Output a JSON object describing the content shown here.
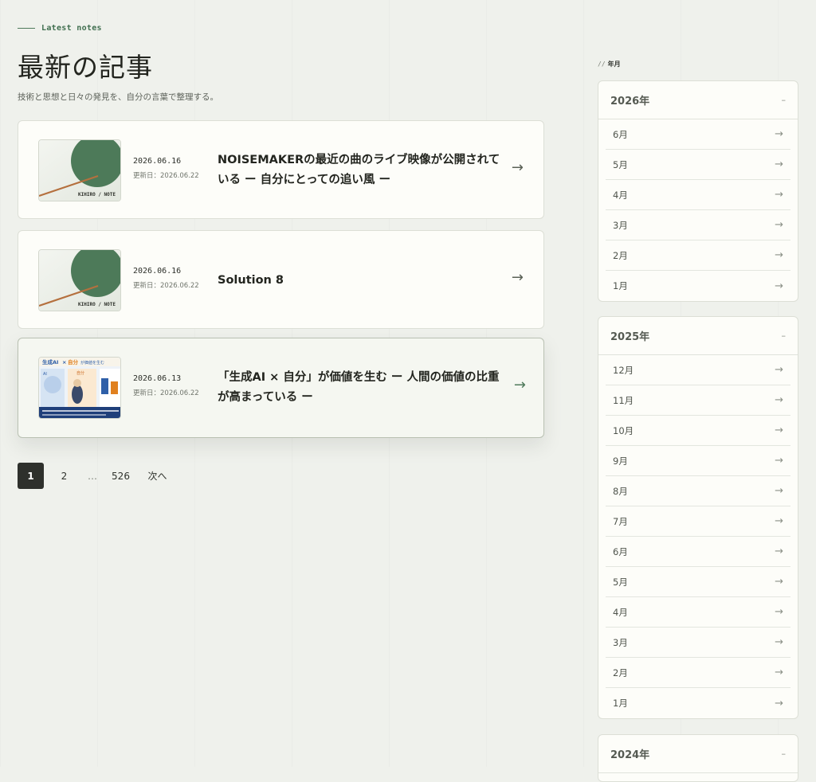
{
  "header": {
    "eyebrow": "Latest notes",
    "title": "最新の記事",
    "subtitle": "技術と思想と日々の発見を、自分の言葉で整理する。"
  },
  "posts": [
    {
      "date": "2026.06.16",
      "updated": "更新日：2026.06.22",
      "title": "NOISEMAKERの最近の曲のライブ映像が公開されている ー 自分にとっての追い風 ー",
      "thumb_caption": "KIHIRO / NOTE",
      "arrow": "→"
    },
    {
      "date": "2026.06.16",
      "updated": "更新日：2026.06.22",
      "title": "Solution 8",
      "thumb_caption": "KIHIRO / NOTE",
      "arrow": "→"
    },
    {
      "date": "2026.06.13",
      "updated": "更新日：2026.06.22",
      "title": "「生成AI × 自分」が価値を生む ー 人間の価値の比重が高まっている ー",
      "thumb_caption": "",
      "arrow": "→"
    }
  ],
  "thumb3": {
    "headline_a": "生成AI",
    "headline_x": "×",
    "headline_b": "自分",
    "headline_c": "が価値を生む",
    "left_label": "AI",
    "center_label": "自分"
  },
  "pagination": {
    "pages": [
      "1",
      "2",
      "…",
      "526"
    ],
    "active": "1",
    "next": "次へ"
  },
  "sidebar": {
    "label_prefix": "//",
    "label": "年月",
    "years": [
      {
        "year": "2026年",
        "toggle": "–",
        "months": [
          "6月",
          "5月",
          "4月",
          "3月",
          "2月",
          "1月"
        ]
      },
      {
        "year": "2025年",
        "toggle": "–",
        "months": [
          "12月",
          "11月",
          "10月",
          "9月",
          "8月",
          "7月",
          "6月",
          "5月",
          "4月",
          "3月",
          "2月",
          "1月"
        ]
      },
      {
        "year": "2024年",
        "toggle": "–",
        "months": []
      }
    ],
    "month_arrow": "→"
  },
  "colors": {
    "background": "#eff1ec",
    "card": "#fdfdf9",
    "accent_green": "#4f7a5b",
    "thumb_circle": "#4d7a59",
    "thumb_line": "#b5703e",
    "pager_active": "#2e302c"
  }
}
